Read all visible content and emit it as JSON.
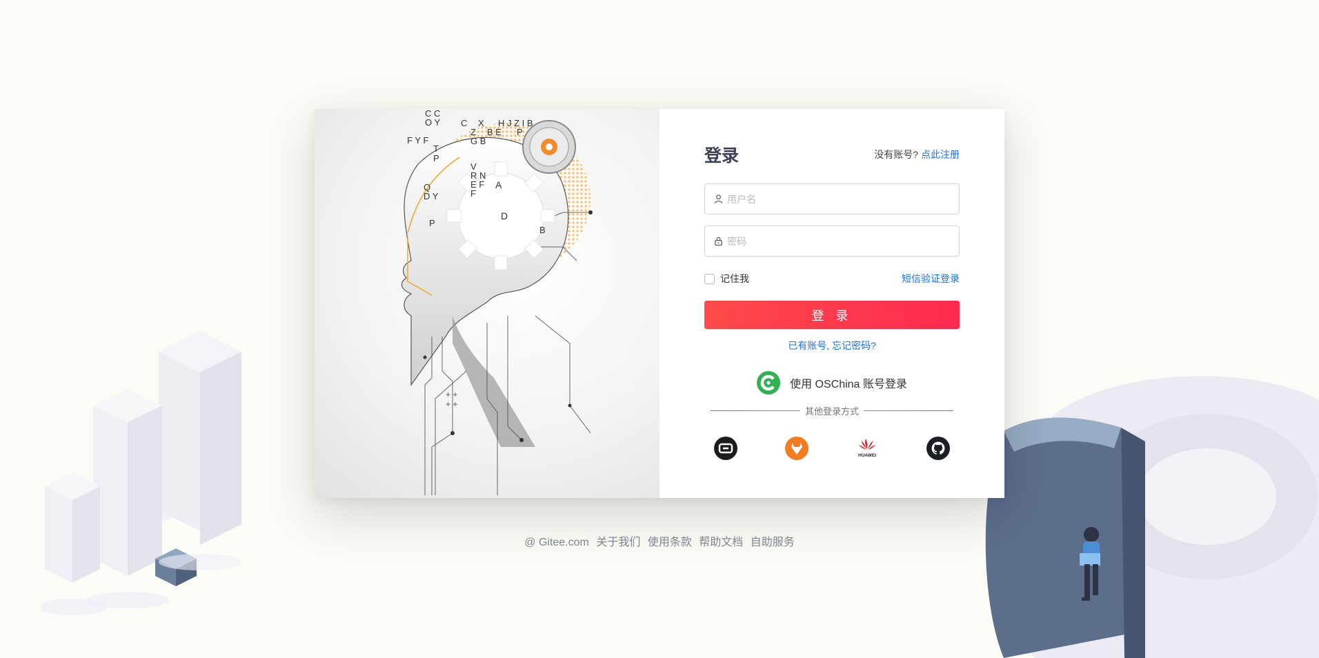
{
  "login": {
    "title": "登录",
    "no_account_text": "没有账号?",
    "register_link": "点此注册",
    "username_placeholder": "用户名",
    "password_placeholder": "密码",
    "remember_me": "记住我",
    "sms_login": "短信验证登录",
    "submit_label": "登 录",
    "forgot_password": "已有账号, 忘记密码?",
    "oschina_login": "使用 OSChina 账号登录",
    "other_methods": "其他登录方式",
    "providers": [
      {
        "name": "aliyun",
        "icon": "aliyun-icon"
      },
      {
        "name": "gitlab",
        "icon": "gitlab-icon"
      },
      {
        "name": "huawei",
        "icon": "huawei-icon",
        "label": "HUAWEI"
      },
      {
        "name": "github",
        "icon": "github-icon"
      }
    ]
  },
  "footer": {
    "copyright": "@ Gitee.com",
    "about": "关于我们",
    "terms": "使用条款",
    "help": "帮助文档",
    "self_service": "自助服务"
  },
  "hero_image": {
    "letters": [
      "C C",
      "O Y",
      "C",
      "X",
      "H J Z I B",
      "Z",
      "B E",
      "P",
      "G B",
      "F Y F",
      "T",
      "P",
      "V",
      "R N",
      "E F",
      "F",
      "Q",
      "D Y",
      "P",
      "A",
      "D",
      "B"
    ]
  },
  "colors": {
    "accent": "#1773f0",
    "primary_button_start": "#fe4a4a",
    "primary_button_end": "#ff2a50",
    "page_bg": "#fcfcf7",
    "title": "#3a4057"
  }
}
